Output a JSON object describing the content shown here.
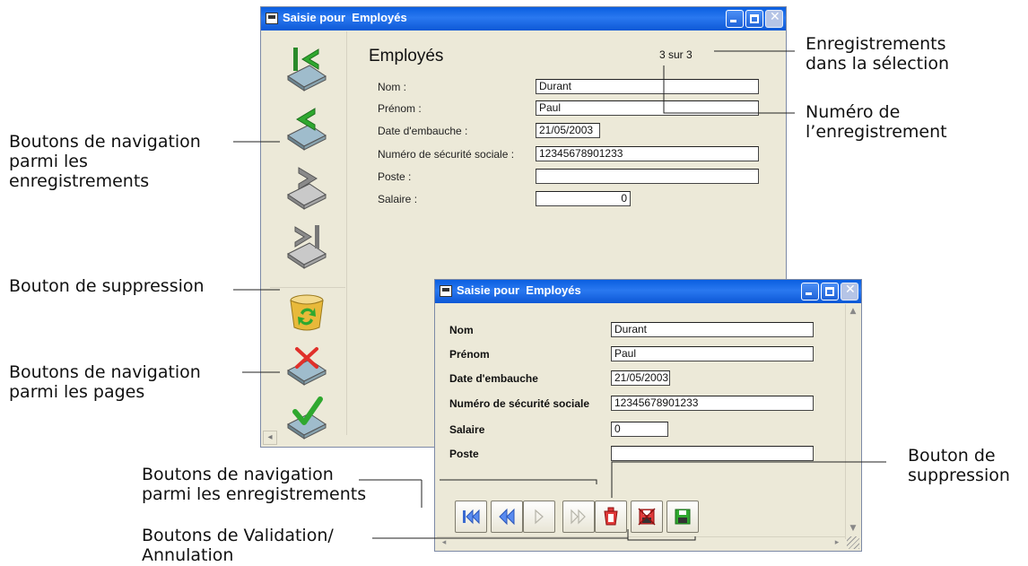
{
  "annotations": {
    "nav_records_left": [
      "Boutons de navigation",
      "parmi les",
      "enregistrements"
    ],
    "delete_button_left": "Bouton de suppression",
    "nav_pages_left": [
      "Boutons de navigation",
      "parmi les pages"
    ],
    "records_in_selection": [
      "Enregistrements",
      "dans la sélection"
    ],
    "record_number": [
      "Numéro de",
      "l’enregistrement"
    ],
    "nav_records_bottom": [
      "Boutons de navigation",
      "parmi les enregistrements"
    ],
    "validation_bottom": [
      "Boutons de Validation/",
      "Annulation"
    ],
    "delete_button_right": [
      "Bouton de",
      "suppression"
    ]
  },
  "window1": {
    "title": "Saisie pour  Employés",
    "form_title": "Employés",
    "record_counter": "3 sur 3",
    "fields": [
      {
        "label": "Nom :",
        "value": "Durant"
      },
      {
        "label": "Prénom :",
        "value": "Paul"
      },
      {
        "label": "Date d'embauche :",
        "value": "21/05/2003"
      },
      {
        "label": "Numéro de sécurité sociale :",
        "value": "12345678901233"
      },
      {
        "label": "Poste :",
        "value": ""
      },
      {
        "label": "Salaire :",
        "value": "0"
      }
    ],
    "icons": [
      "first-record-icon",
      "previous-record-icon",
      "next-record-icon",
      "last-record-icon",
      "delete-record-icon",
      "cancel-icon",
      "validate-icon"
    ]
  },
  "window2": {
    "title": "Saisie pour  Employés",
    "fields": [
      {
        "label": "Nom",
        "value": "Durant"
      },
      {
        "label": "Prénom",
        "value": "Paul"
      },
      {
        "label": "Date d'embauche",
        "value": "21/05/2003"
      },
      {
        "label": "Numéro de sécurité sociale",
        "value": "12345678901233"
      },
      {
        "label": "Salaire",
        "value": "0"
      },
      {
        "label": "Poste",
        "value": ""
      }
    ],
    "toolbar_icons": [
      "first-record-icon",
      "previous-record-icon",
      "next-record-icon",
      "last-record-icon",
      "delete-icon",
      "cancel-icon",
      "save-icon"
    ]
  }
}
